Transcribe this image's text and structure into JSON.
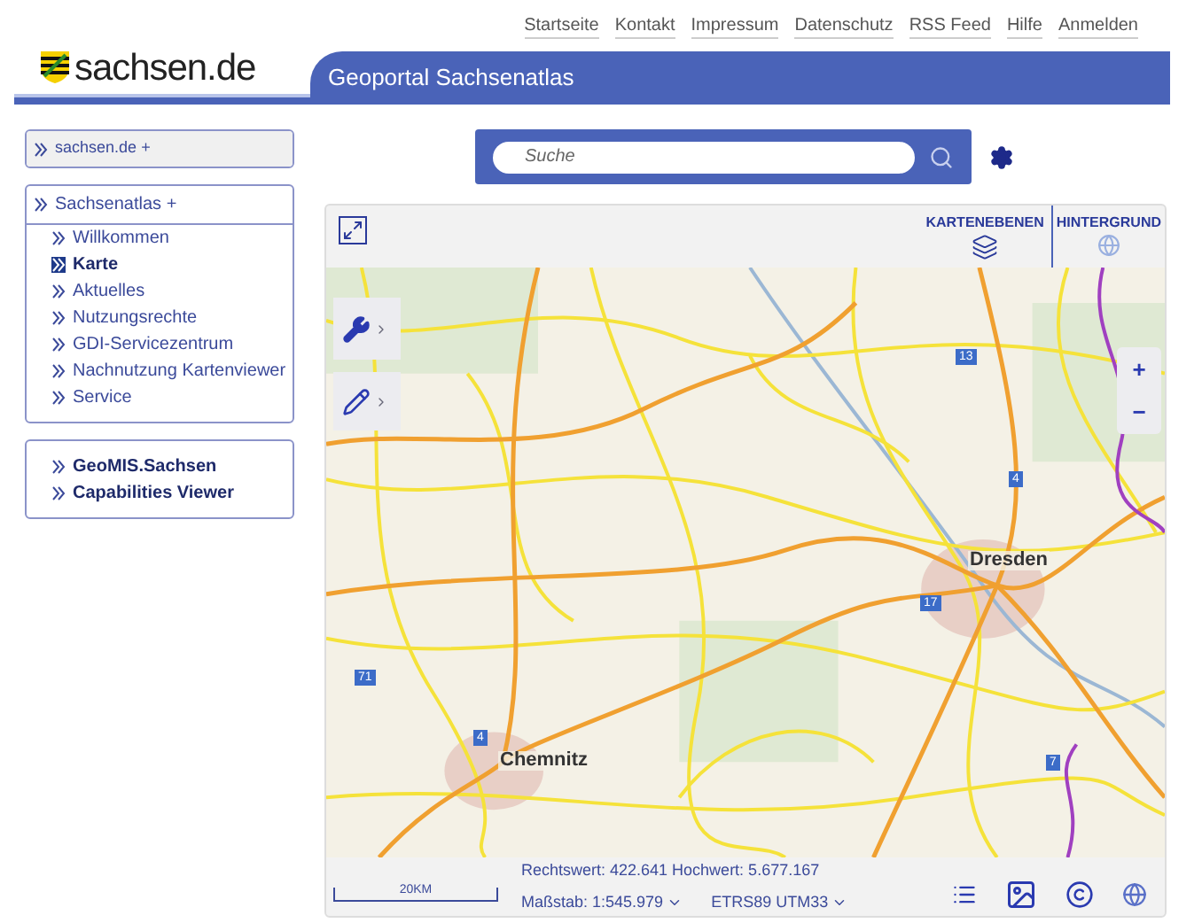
{
  "top_links": [
    "Startseite",
    "Kontakt",
    "Impressum",
    "Datenschutz",
    "RSS Feed",
    "Hilfe",
    "Anmelden"
  ],
  "logo": "sachsen.de",
  "banner_title": "Geoportal Sachsenatlas",
  "sidebar": {
    "sections": [
      {
        "items": [
          {
            "label": "sachsen.de",
            "suffix": "+",
            "kind": "header"
          }
        ]
      },
      {
        "items": [
          {
            "label": "Sachsenatlas",
            "suffix": "+",
            "kind": "header"
          },
          {
            "label": "Willkommen",
            "kind": "link",
            "selected": false
          },
          {
            "label": "Karte",
            "kind": "link",
            "selected": true
          },
          {
            "label": "Aktuelles",
            "kind": "link",
            "selected": false
          },
          {
            "label": "Nutzungsrechte",
            "kind": "link",
            "selected": false
          },
          {
            "label": "GDI-Servicezentrum",
            "kind": "link",
            "selected": false
          },
          {
            "label": "Nachnutzung Kartenviewer",
            "kind": "link",
            "selected": false
          },
          {
            "label": "Service",
            "kind": "link",
            "selected": false
          }
        ]
      },
      {
        "items": [
          {
            "label": "GeoMIS.Sachsen",
            "kind": "bold"
          },
          {
            "label": "Capabilities Viewer",
            "kind": "bold"
          }
        ]
      }
    ]
  },
  "search": {
    "placeholder": "Suche"
  },
  "map": {
    "layers_label": "KARTENEBENEN",
    "background_label": "HINTERGRUND",
    "places": [
      {
        "label": "Dresden",
        "kind": "city"
      },
      {
        "label": "Chemnitz",
        "kind": "city"
      },
      {
        "label": "13",
        "kind": "shield"
      },
      {
        "label": "4",
        "kind": "shield"
      },
      {
        "label": "17",
        "kind": "shield"
      },
      {
        "label": "71",
        "kind": "shield"
      },
      {
        "label": "4",
        "kind": "shield"
      },
      {
        "label": "7",
        "kind": "shield"
      }
    ],
    "zoom_in": "+",
    "zoom_out": "−"
  },
  "status": {
    "scale_bar": "20KM",
    "coordinates": "Rechtswert: 422.641 Hochwert: 5.677.167",
    "scale": "Maßstab: 1:545.979",
    "crs": "ETRS89 UTM33"
  }
}
